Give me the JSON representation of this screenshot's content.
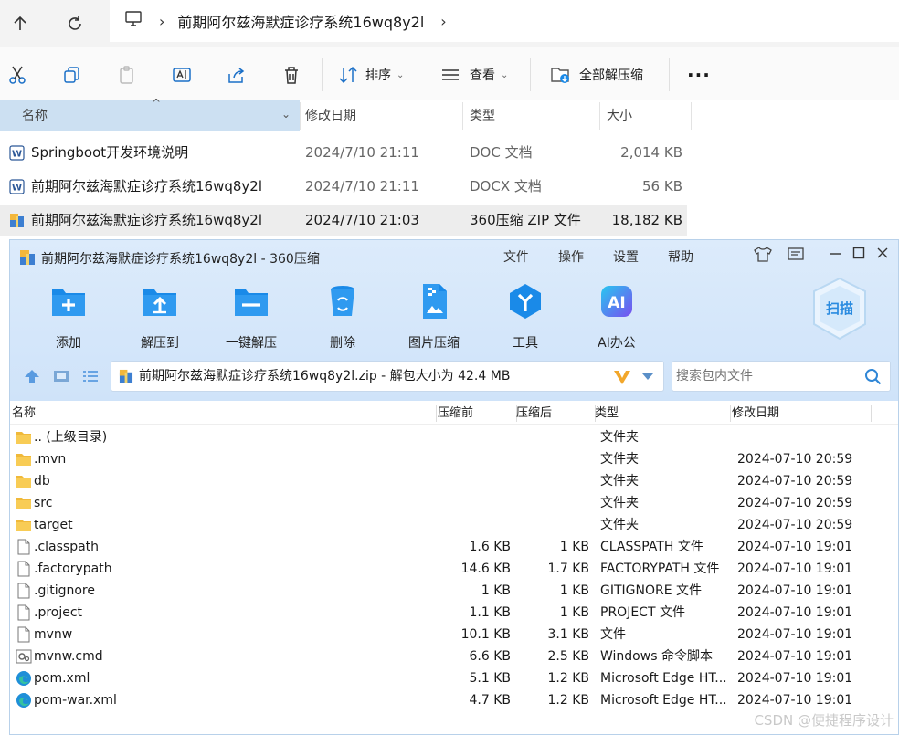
{
  "explorer": {
    "breadcrumb": "前期阿尔兹海默症诊疗系统16wq8y2l",
    "commands": {
      "sort": "排序",
      "view": "查看",
      "extract_all": "全部解压缩"
    },
    "columns": {
      "name": "名称",
      "modified": "修改日期",
      "type": "类型",
      "size": "大小"
    },
    "files": [
      {
        "name": "Springboot开发环境说明",
        "modified": "2024/7/10 21:11",
        "type": "DOC 文档",
        "size": "2,014 KB",
        "icon": "word-icon"
      },
      {
        "name": "前期阿尔兹海默症诊疗系统16wq8y2l",
        "modified": "2024/7/10 21:11",
        "type": "DOCX 文档",
        "size": "56 KB",
        "icon": "word-icon"
      },
      {
        "name": "前期阿尔兹海默症诊疗系统16wq8y2l",
        "modified": "2024/7/10 21:03",
        "type": "360压缩 ZIP 文件",
        "size": "18,182 KB",
        "icon": "zip-icon"
      }
    ]
  },
  "zipwin": {
    "title": "前期阿尔兹海默症诊疗系统16wq8y2l - 360压缩",
    "menu": [
      "文件",
      "操作",
      "设置",
      "帮助"
    ],
    "tools": [
      {
        "label": "添加",
        "icon": "add-icon"
      },
      {
        "label": "解压到",
        "icon": "extract-to-icon"
      },
      {
        "label": "一键解压",
        "icon": "one-click-extract-icon"
      },
      {
        "label": "删除",
        "icon": "delete-icon"
      },
      {
        "label": "图片压缩",
        "icon": "image-compress-icon"
      },
      {
        "label": "工具",
        "icon": "tools-icon"
      },
      {
        "label": "AI办公",
        "icon": "ai-office-icon"
      }
    ],
    "scan_label": "扫描",
    "path": "前期阿尔兹海默症诊疗系统16wq8y2l.zip - 解包大小为 42.4 MB",
    "search_placeholder": "搜索包内文件",
    "columns": {
      "name": "名称",
      "before": "压缩前",
      "after": "压缩后",
      "type": "类型",
      "modified": "修改日期"
    },
    "rows": [
      {
        "name": ".. (上级目录)",
        "before": "",
        "after": "",
        "type": "文件夹",
        "modified": "",
        "icon": "folder-icon"
      },
      {
        "name": ".mvn",
        "before": "",
        "after": "",
        "type": "文件夹",
        "modified": "2024-07-10 20:59",
        "icon": "folder-icon"
      },
      {
        "name": "db",
        "before": "",
        "after": "",
        "type": "文件夹",
        "modified": "2024-07-10 20:59",
        "icon": "folder-icon"
      },
      {
        "name": "src",
        "before": "",
        "after": "",
        "type": "文件夹",
        "modified": "2024-07-10 20:59",
        "icon": "folder-icon"
      },
      {
        "name": "target",
        "before": "",
        "after": "",
        "type": "文件夹",
        "modified": "2024-07-10 20:59",
        "icon": "folder-icon"
      },
      {
        "name": ".classpath",
        "before": "1.6 KB",
        "after": "1 KB",
        "type": "CLASSPATH 文件",
        "modified": "2024-07-10 19:01",
        "icon": "file-icon"
      },
      {
        "name": ".factorypath",
        "before": "14.6 KB",
        "after": "1.7 KB",
        "type": "FACTORYPATH 文件",
        "modified": "2024-07-10 19:01",
        "icon": "file-icon"
      },
      {
        "name": ".gitignore",
        "before": "1 KB",
        "after": "1 KB",
        "type": "GITIGNORE 文件",
        "modified": "2024-07-10 19:01",
        "icon": "file-icon"
      },
      {
        "name": ".project",
        "before": "1.1 KB",
        "after": "1 KB",
        "type": "PROJECT 文件",
        "modified": "2024-07-10 19:01",
        "icon": "file-icon"
      },
      {
        "name": "mvnw",
        "before": "10.1 KB",
        "after": "3.1 KB",
        "type": "文件",
        "modified": "2024-07-10 19:01",
        "icon": "file-icon"
      },
      {
        "name": "mvnw.cmd",
        "before": "6.6 KB",
        "after": "2.5 KB",
        "type": "Windows 命令脚本",
        "modified": "2024-07-10 19:01",
        "icon": "cmd-script-icon"
      },
      {
        "name": "pom.xml",
        "before": "5.1 KB",
        "after": "1.2 KB",
        "type": "Microsoft Edge HT...",
        "modified": "2024-07-10 19:01",
        "icon": "edge-icon"
      },
      {
        "name": "pom-war.xml",
        "before": "4.7 KB",
        "after": "1.2 KB",
        "type": "Microsoft Edge HT...",
        "modified": "2024-07-10 19:01",
        "icon": "edge-icon"
      }
    ]
  },
  "watermark": "CSDN @便捷程序设计",
  "colors": {
    "accent": "#1a8ae8",
    "selection": "#cce0f2",
    "zip_header": "#dcebfb"
  }
}
